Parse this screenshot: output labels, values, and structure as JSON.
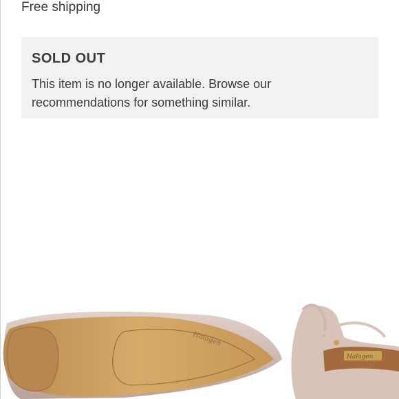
{
  "shipping": {
    "text": "Free shipping"
  },
  "notice": {
    "title": "SOLD OUT",
    "message": "This item is no longer available. Browse our recommendations for something similar."
  },
  "product_image": {
    "description_icon": "shoe-sole-icon",
    "brand_mark": "Halogen"
  },
  "colors": {
    "notice_background": "#f2f2f2",
    "text": "#3a3a3a",
    "sole": "#c79a5c",
    "upper": "#c9aea4"
  }
}
